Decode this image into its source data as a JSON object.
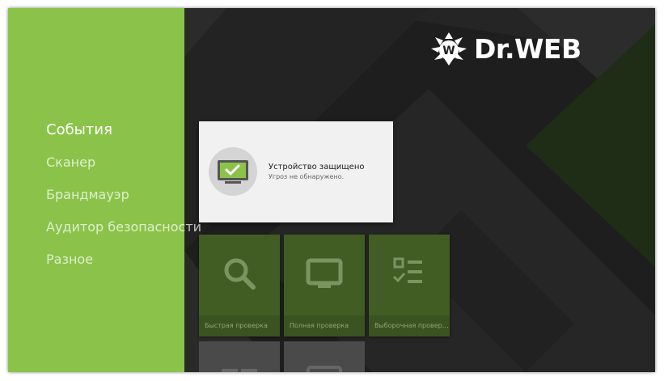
{
  "sidebar": {
    "items": [
      {
        "label": "События",
        "active": true
      },
      {
        "label": "Сканер"
      },
      {
        "label": "Брандмауэр"
      },
      {
        "label": "Аудитор безопасности"
      },
      {
        "label": "Разное"
      }
    ]
  },
  "logo": {
    "text": "Dr.WEB"
  },
  "status": {
    "title": "Устройство защищено",
    "subtitle": "Угроз не обнаружено."
  },
  "tiles": [
    {
      "label": "Быстрая проверка",
      "icon": "search-icon"
    },
    {
      "label": "Полная проверка",
      "icon": "monitor-icon"
    },
    {
      "label": "Выборочная проверка",
      "icon": "checklist-icon"
    }
  ],
  "colors": {
    "accent": "#8bc34a",
    "tile": "#425d24",
    "background": "#1d1d1d"
  }
}
